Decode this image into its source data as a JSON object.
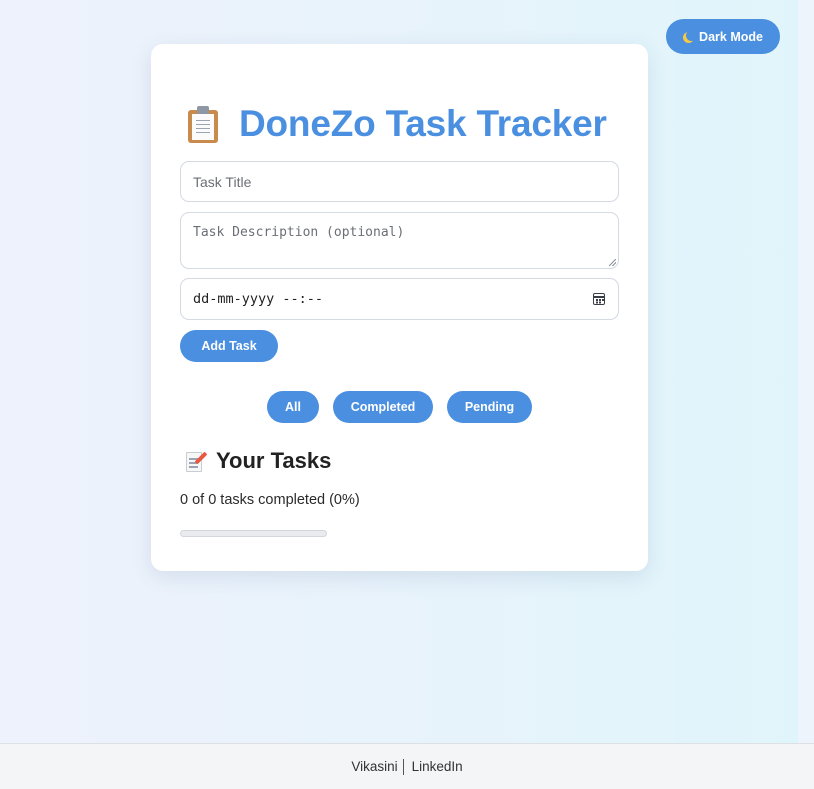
{
  "header": {
    "dark_mode_label": "Dark Mode",
    "dark_mode_icon": "moon-icon"
  },
  "card": {
    "title": "DoneZo Task Tracker",
    "title_icon": "clipboard-icon",
    "accent_color": "#4a8fe0"
  },
  "form": {
    "task_title_placeholder": "Task Title",
    "task_title_value": "",
    "task_description_placeholder": "Task Description (optional)",
    "task_description_value": "",
    "due_date_placeholder": "dd-mm-yyyy --:--",
    "due_date_icon": "calendar-icon",
    "add_button_label": "Add Task"
  },
  "filters": {
    "all": "All",
    "completed": "Completed",
    "pending": "Pending"
  },
  "tasks": {
    "heading": "Your Tasks",
    "heading_icon": "memo-icon",
    "progress_text": "0 of 0 tasks completed (0%)",
    "progress_percent": 0,
    "items": []
  },
  "footer": {
    "author": "Vikasini",
    "link": "LinkedIn"
  }
}
